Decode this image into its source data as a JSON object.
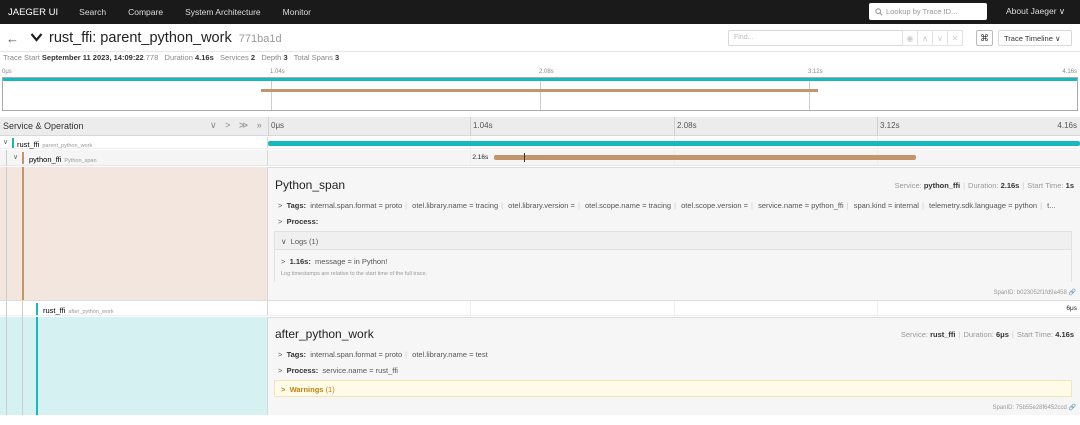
{
  "nav": {
    "brand": "JAEGER UI",
    "items": [
      "Search",
      "Compare",
      "System Architecture",
      "Monitor"
    ],
    "lookup_placeholder": "Lookup by Trace ID...",
    "about": "About Jaeger ∨"
  },
  "trace": {
    "name": "rust_ffi: parent_python_work",
    "id": "771ba1d",
    "find_placeholder": "Find...",
    "view_mode": "Trace Timeline ∨",
    "kbd_label": "⌘"
  },
  "summary": {
    "start_label": "Trace Start",
    "start_value": "September 11 2023, 14:09:22",
    "start_ms": ".778",
    "duration_label": "Duration",
    "duration_value": "4.16s",
    "services_label": "Services",
    "services_value": "2",
    "depth_label": "Depth",
    "depth_value": "3",
    "spans_label": "Total Spans",
    "spans_value": "3"
  },
  "minimap_ticks": [
    "0μs",
    "1.04s",
    "2.08s",
    "3.12s",
    "4.16s"
  ],
  "header": {
    "label": "Service & Operation",
    "controls": "∨ > ≫ »",
    "ticks": [
      "0μs",
      "1.04s",
      "2.08s",
      "3.12s",
      "4.16s"
    ]
  },
  "colors": {
    "rust": "#17b8be",
    "python": "#c4956a",
    "nav_bg": "#1a1a1a"
  },
  "spans": [
    {
      "service": "rust_ffi",
      "operation": "parent_python_work",
      "start_frac": 0.0,
      "dur_frac": 1.0
    },
    {
      "service": "python_ffi",
      "operation": "Python_span",
      "start_frac": 0.2788,
      "dur_frac": 0.5192,
      "label": "2.16s"
    },
    {
      "service": "rust_ffi",
      "operation": "after_python_work",
      "start_frac": 0.99999,
      "dur_frac": 0.0,
      "label": "6μs"
    }
  ],
  "detail1": {
    "title": "Python_span",
    "service_label": "Service:",
    "service": "python_ffi",
    "duration_label": "Duration:",
    "duration": "2.16s",
    "start_label": "Start Time:",
    "start": "1s",
    "tags_label": "Tags:",
    "tags": [
      "internal.span.format = proto",
      "otel.library.name = tracing",
      "otel.library.version =",
      "otel.scope.name = tracing",
      "otel.scope.version =",
      "service.name = python_ffi",
      "span.kind = internal",
      "telemetry.sdk.language = python",
      "t..."
    ],
    "process_label": "Process:",
    "logs_label": "Logs",
    "logs_count": "(1)",
    "log_time": "1.16s:",
    "log_msg": "message = in Python!",
    "log_note": "Log timestamps are relative to the start time of the full trace.",
    "span_id": "SpanID: b023052f1fd9a458"
  },
  "detail2": {
    "title": "after_python_work",
    "service_label": "Service:",
    "service": "rust_ffi",
    "duration_label": "Duration:",
    "duration": "6μs",
    "start_label": "Start Time:",
    "start": "4.16s",
    "tags_label": "Tags:",
    "tags": [
      "internal.span.format = proto",
      "otel.library.name = test"
    ],
    "process_label": "Process:",
    "process_value": "service.name = rust_ffi",
    "warnings_label": "Warnings",
    "warnings_count": "(1)",
    "span_id": "SpanID: 75b55e28f6452ccd"
  }
}
